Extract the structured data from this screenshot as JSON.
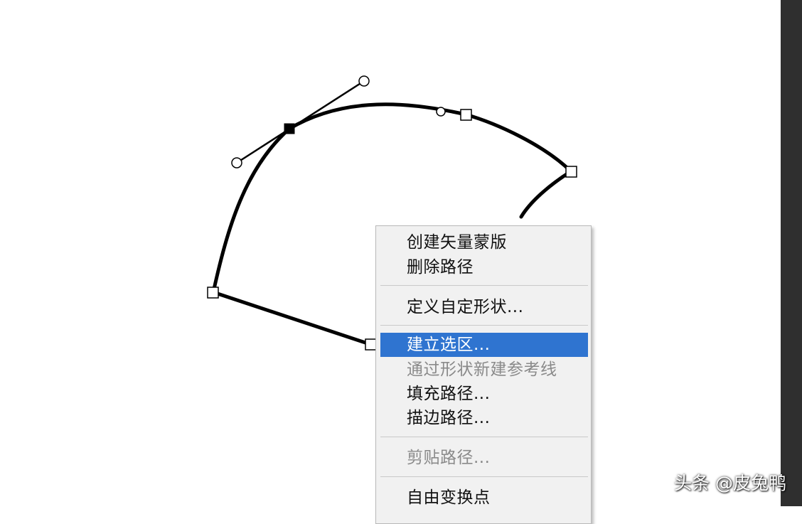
{
  "context_menu": {
    "items": [
      {
        "label": "创建矢量蒙版",
        "enabled": true
      },
      {
        "label": "删除路径",
        "enabled": true
      },
      {
        "label": "定义自定形状...",
        "enabled": true
      },
      {
        "label": "建立选区...",
        "enabled": true,
        "highlighted": true
      },
      {
        "label": "通过形状新建参考线",
        "enabled": false
      },
      {
        "label": "填充路径...",
        "enabled": true
      },
      {
        "label": "描边路径...",
        "enabled": true
      },
      {
        "label": "剪贴路径...",
        "enabled": false
      },
      {
        "label": "自由变换点",
        "enabled": true
      }
    ]
  },
  "watermark": "头条 @皮兔鸭",
  "colors": {
    "highlight": "#2f74d0",
    "menu_background": "#f1f1f1",
    "disabled_text": "#8a8a8a",
    "path_stroke": "#000000"
  }
}
